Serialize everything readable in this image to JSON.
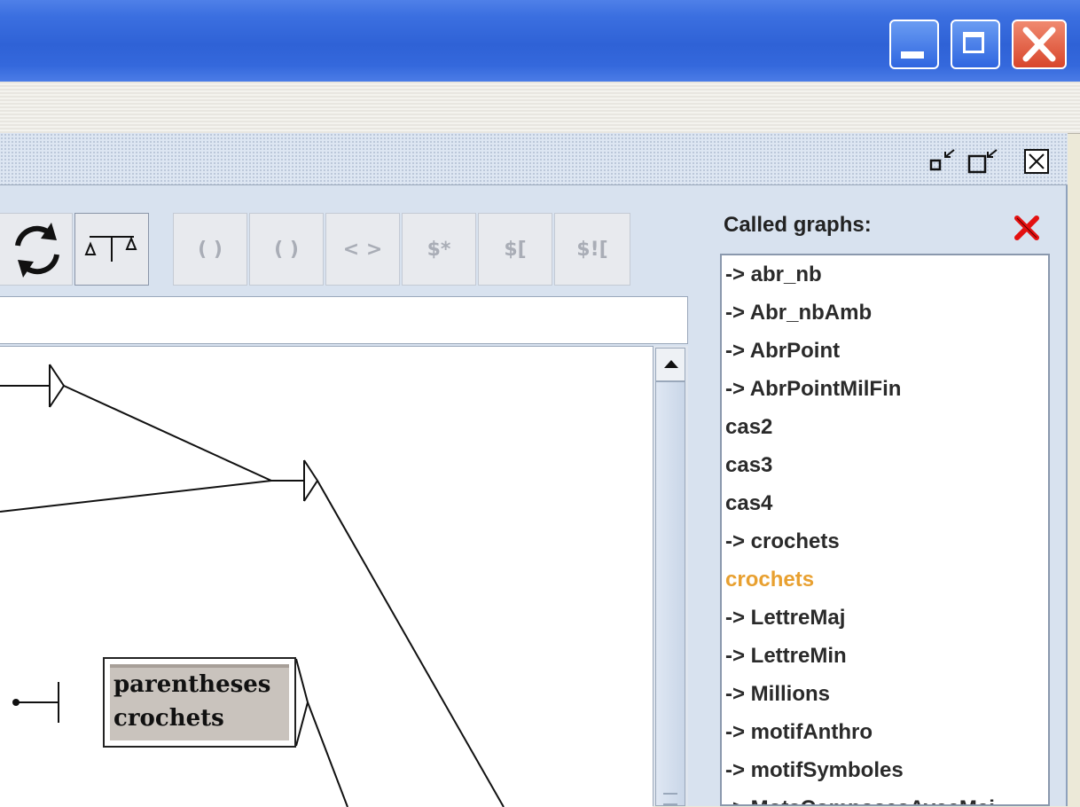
{
  "window": {
    "controls": [
      "minimize-icon",
      "maximize-icon",
      "close-icon"
    ],
    "colors": {
      "titlebar": "#2f62d6",
      "close": "#d8462c"
    }
  },
  "toolbar": {
    "enabled_icons": [
      "refresh-icon",
      "balance-icon"
    ],
    "disabled_buttons": [
      "( )",
      "( )",
      "< >",
      "$*",
      "$[",
      "$!["
    ]
  },
  "graph": {
    "box_lines": [
      "parentheses",
      "crochets"
    ]
  },
  "called_graphs": {
    "title": "Called graphs:",
    "items": [
      "-> abr_nb",
      "-> Abr_nbAmb",
      "-> AbrPoint",
      "-> AbrPointMilFin",
      "cas2",
      "cas3",
      "cas4",
      "-> crochets",
      "crochets",
      "-> LettreMaj",
      "-> LettreMin",
      "-> Millions",
      "-> motifAnthro",
      "-> motifSymboles",
      "-> MotsComposesAvecMaj"
    ],
    "selected_index": 8,
    "colors": {
      "selected": "#e8a030",
      "text": "#2a2a2a"
    }
  }
}
